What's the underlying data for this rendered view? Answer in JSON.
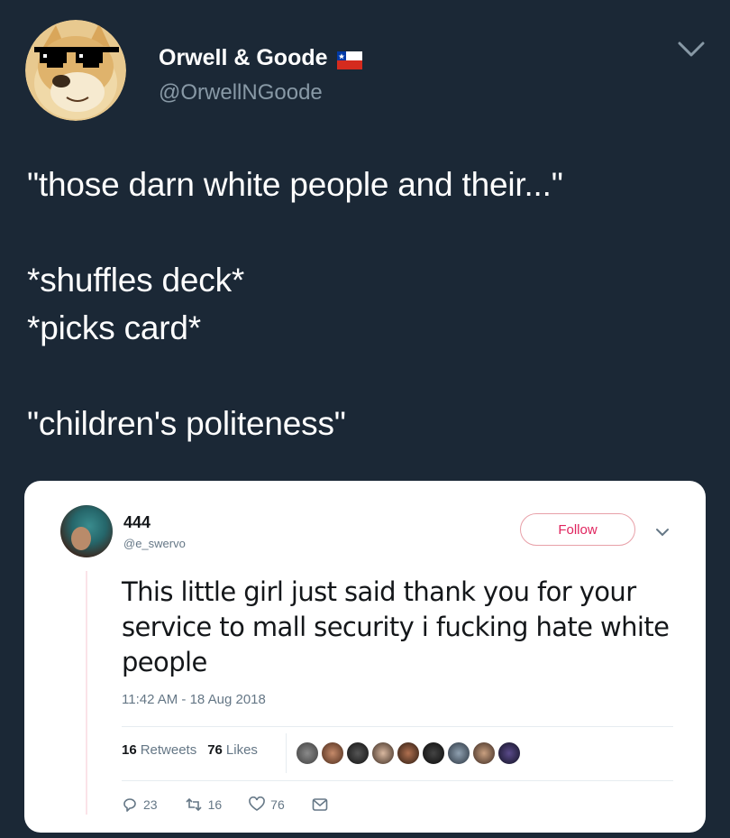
{
  "outer_tweet": {
    "author_name": "Orwell & Goode",
    "author_handle": "@OrwellNGoode",
    "text": "\"those darn white people and their...\"\n\n*shuffles deck*\n*picks card*\n\n\"children's politeness\""
  },
  "quoted_tweet": {
    "author_name": "444",
    "author_handle": "@e_swervo",
    "follow_label": "Follow",
    "text": "This little girl just said thank you for your service to mall security i fucking hate white people",
    "timestamp": "11:42 AM - 18 Aug 2018",
    "retweets_count": "16",
    "retweets_label": "Retweets",
    "likes_count": "76",
    "likes_label": "Likes",
    "actions": {
      "replies": "23",
      "retweets": "16",
      "likes": "76"
    }
  },
  "colors": {
    "background": "#1b2836",
    "handle": "#8899a6",
    "follow_accent": "#e0245e"
  },
  "icons": [
    "doge-sunglasses-avatar",
    "chile-flag-icon",
    "chevron-down-icon",
    "reply-icon",
    "retweet-icon",
    "heart-icon",
    "message-icon"
  ]
}
